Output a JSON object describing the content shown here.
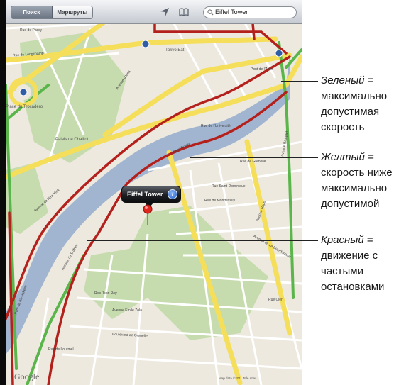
{
  "toolbar": {
    "tabs": [
      {
        "label": "Поиск",
        "active": true
      },
      {
        "label": "Маршруты",
        "active": false
      }
    ],
    "location_icon": "location-arrow-icon",
    "bookmarks_icon": "bookmarks-book-icon",
    "search": {
      "value": "Eiffel Tower",
      "icon": "search-icon"
    }
  },
  "map": {
    "labels": {
      "rue_de_longchamp": "Rue de Longchamp",
      "place_trocadero": "Place du Trocadéro",
      "palais_chaillot": "Palais de Chaillot",
      "avenue_iena": "Avenue d'Iéna",
      "quai_branly": "Quai Branly",
      "avenue_new_york": "Avenue de New York",
      "rue_de_passy": "Rue de Passy",
      "pont_de_bir_hakeim": "Pont de Bir-Hakeim",
      "rue_de_grenelle": "Rue de Grenelle",
      "avenue_rapp": "Avenue Rapp",
      "avenue_bosquet": "Avenue Bosquet",
      "rue_jean_rey": "Rue Jean Rey",
      "avenue_de_suffren": "Avenue de Suffren",
      "avenue_de_la_bourdonnais": "Avenue de La Bourdonnais",
      "rue_st_dominique": "Rue Saint-Dominique",
      "rue_de_monttessuy": "Rue de Monttessuy",
      "tokyo_eat": "Tokyo Eat",
      "pont_de_l_alma": "Pont de l'Alma",
      "rue_de_l_universite": "Rue de l'Université",
      "rue_cler": "Rue Cler",
      "boulevard_de_grenelle": "Boulevard de Grenelle",
      "rue_de_lourmel": "Rue de Lourmel",
      "avenue_emile_zola": "Avenue Émile Zola"
    },
    "callout": {
      "title": "Eiffel Tower",
      "info_icon": "info-icon"
    },
    "pin_icon": "red-pin-icon",
    "google_logo": "Google",
    "copyright": "Map data ©2011 Tele Atlas",
    "colors": {
      "green": "#5ab54a",
      "yellow": "#f5de5a",
      "red": "#b4201c",
      "water": "#a1b5d1",
      "park": "#c6dcae"
    }
  },
  "legend": [
    {
      "key": "Зеленый",
      "eq": " =",
      "lines": [
        "максимально",
        "допустимая",
        "скорость"
      ]
    },
    {
      "key": "Желтый",
      "eq": " =",
      "lines": [
        "скорость ниже",
        "максимально",
        "допустимой"
      ]
    },
    {
      "key": "Красный",
      "eq": " =",
      "lines": [
        "движение с",
        "частыми",
        "остановками"
      ]
    }
  ]
}
